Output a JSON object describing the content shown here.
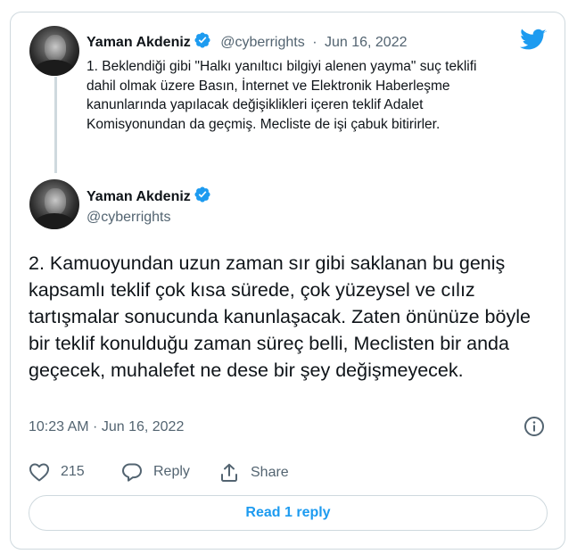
{
  "tweet1": {
    "name": "Yaman Akdeniz",
    "handle": "@cyberrights",
    "separator": "·",
    "date": "Jun 16, 2022",
    "text": "1. Beklendiği gibi \"Halkı yanıltıcı bilgiyi alenen yayma\" suç teklifi dahil olmak üzere Basın, İnternet ve Elektronik Haberleşme kanunlarında yapılacak değişiklikleri içeren teklif Adalet Komisyonundan da geçmiş. Mecliste de işi çabuk bitirirler."
  },
  "tweet2": {
    "name": "Yaman Akdeniz",
    "handle": "@cyberrights",
    "text": "2. Kamuoyundan uzun zaman sır gibi saklanan bu geniş kapsamlı teklif çok kısa sürede, çok yüzeysel ve cılız tartışmalar sonucunda kanunlaşacak. Zaten önünüze böyle bir teklif konulduğu zaman süreç belli, Meclisten bir anda geçecek, muhalefet ne dese bir şey değişmeyecek.",
    "timestamp": "10:23 AM · Jun 16, 2022"
  },
  "actions": {
    "likes_count": "215",
    "reply_label": "Reply",
    "share_label": "Share"
  },
  "read_reply_label": "Read 1 reply",
  "icons": {
    "brand": "twitter-bird-icon",
    "verified": "verified-badge-icon",
    "like": "heart-icon",
    "reply": "speech-bubble-icon",
    "share": "share-arrow-icon",
    "info": "info-icon"
  },
  "colors": {
    "accent": "#1d9bf0",
    "text": "#0f1419",
    "muted": "#536471",
    "border": "#cfd9de"
  }
}
